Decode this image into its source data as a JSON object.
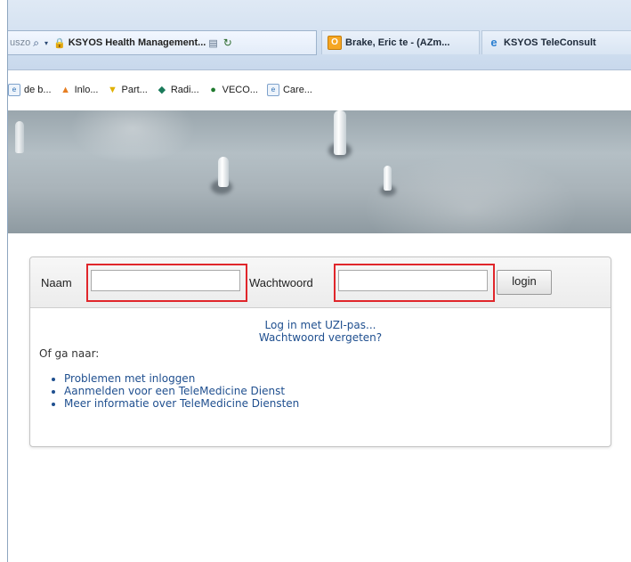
{
  "browser": {
    "address_partial": "uszo",
    "address_title": "KSYOS Health Management...",
    "tabs": [
      {
        "label": "Brake, Eric te - (AZm...",
        "icon": "outlook-icon"
      },
      {
        "label": "KSYOS TeleConsult",
        "icon": "ie-page-icon"
      }
    ],
    "favorites": [
      {
        "label": "de b...",
        "icon": "page-icon"
      },
      {
        "label": "Inlo...",
        "icon": "orange-icon"
      },
      {
        "label": "Part...",
        "icon": "shield-icon"
      },
      {
        "label": "Radi...",
        "icon": "radi-icon"
      },
      {
        "label": "VECO...",
        "icon": "globe-icon"
      },
      {
        "label": "Care...",
        "icon": "page-icon"
      }
    ]
  },
  "login": {
    "naam_label": "Naam",
    "naam_value": "",
    "wachtwoord_label": "Wachtwoord",
    "wachtwoord_value": "",
    "login_button": "login",
    "uzi_link": "Log in met UZI-pas...",
    "forgot_link": "Wachtwoord vergeten?",
    "ofga": "Of ga naar:",
    "links": [
      "Problemen met inloggen",
      "Aanmelden voor een TeleMedicine Dienst",
      "Meer informatie over TeleMedicine Diensten"
    ]
  },
  "colors": {
    "highlight": "#e0262b",
    "link": "#1f4f8f"
  }
}
